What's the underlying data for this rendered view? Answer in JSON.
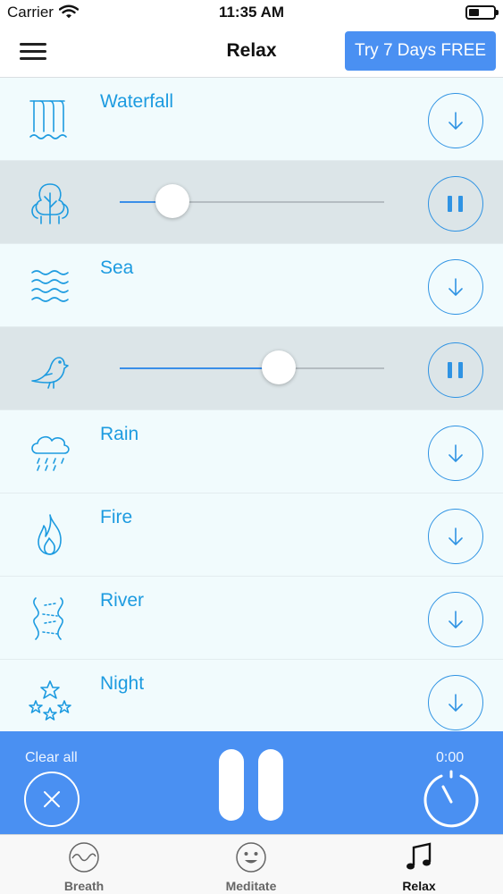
{
  "status_bar": {
    "carrier": "Carrier",
    "time": "11:35 AM"
  },
  "nav": {
    "title": "Relax",
    "trial_button": "Try 7 Days FREE"
  },
  "sounds": [
    {
      "name": "Waterfall",
      "icon": "waterfall-icon",
      "state": "download"
    },
    {
      "name": "",
      "icon": "tree-icon",
      "state": "playing",
      "volume": 0.2
    },
    {
      "name": "Sea",
      "icon": "sea-waves-icon",
      "state": "download"
    },
    {
      "name": "",
      "icon": "bird-icon",
      "state": "playing",
      "volume": 0.6
    },
    {
      "name": "Rain",
      "icon": "rain-cloud-icon",
      "state": "download"
    },
    {
      "name": "Fire",
      "icon": "fire-icon",
      "state": "download"
    },
    {
      "name": "River",
      "icon": "river-icon",
      "state": "download"
    },
    {
      "name": "Night",
      "icon": "stars-icon",
      "state": "download"
    }
  ],
  "player": {
    "clear_label": "Clear all",
    "timer": "0:00"
  },
  "tabs": [
    {
      "label": "Breath",
      "icon": "breath-wave-icon",
      "active": false
    },
    {
      "label": "Meditate",
      "icon": "smiley-icon",
      "active": false
    },
    {
      "label": "Relax",
      "icon": "music-note-icon",
      "active": true
    }
  ],
  "colors": {
    "accent": "#4a90f2",
    "label": "#1d9be0",
    "row_bg": "#f1fbfd",
    "playing_row_bg": "#dce5e8"
  }
}
